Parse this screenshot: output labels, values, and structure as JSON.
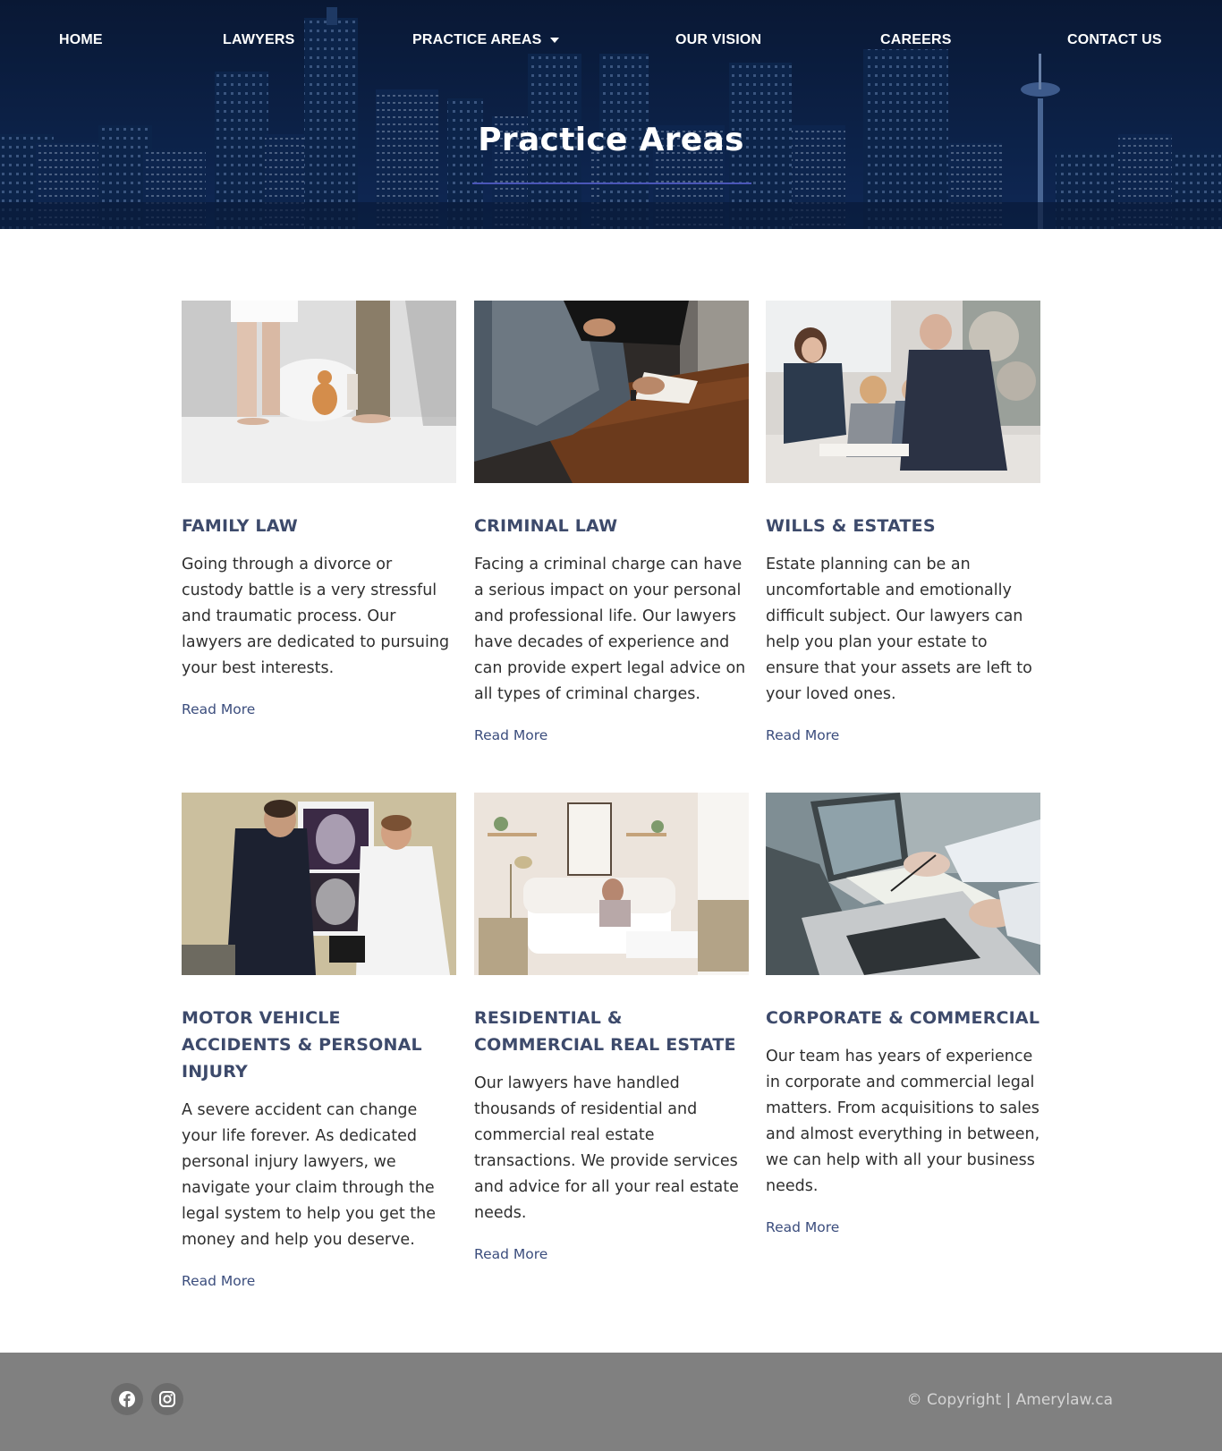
{
  "colors": {
    "hero_bg": "#0d2244",
    "title_color": "#3d4a6b",
    "link_color": "#3b4d7d",
    "footer_bg": "#808080",
    "accent_underline": "#4a56b8"
  },
  "nav": {
    "items": [
      {
        "label": "HOME"
      },
      {
        "label": "LAWYERS"
      },
      {
        "label": "PRACTICE AREAS",
        "icon": "caret-down-icon"
      },
      {
        "label": "OUR VISION"
      },
      {
        "label": "CAREERS"
      },
      {
        "label": "CONTACT US"
      }
    ]
  },
  "hero": {
    "title": "Practice Areas"
  },
  "cards": [
    {
      "title": "FAMILY LAW",
      "text": "Going through a divorce or custody battle is a very stressful and traumatic process. Our lawyers are dedicated to pursuing your best interests.",
      "link": "Read More",
      "image": "couple-with-cat-photo"
    },
    {
      "title": "CRIMINAL LAW",
      "text": "Facing a criminal charge can have a serious impact on your personal and professional life. Our lawyers have decades of experience and can provide expert legal advice on all types of criminal charges.",
      "link": "Read More",
      "image": "signing-document-photo"
    },
    {
      "title": "WILLS & ESTATES",
      "text": "Estate planning can be an uncomfortable and emotionally difficult subject. Our lawyers can help you plan your estate to ensure that your assets are left to your loved ones.",
      "link": "Read More",
      "image": "family-reading-photo"
    },
    {
      "title": "MOTOR VEHICLE ACCIDENTS & PERSONAL INJURY",
      "text": "A severe accident can change your life forever. As dedicated personal injury lawyers, we navigate your claim through the legal system to help you get the money and help you deserve.",
      "link": "Read More",
      "image": "doctor-xray-photo"
    },
    {
      "title": "RESIDENTIAL & COMMERCIAL REAL ESTATE",
      "text": "Our lawyers have handled thousands of residential and commercial real estate transactions. We provide services and advice for all your real estate needs.",
      "link": "Read More",
      "image": "living-room-photo"
    },
    {
      "title": "CORPORATE & COMMERCIAL",
      "text": "Our team has years of experience in corporate and commercial legal matters. From acquisitions to sales and almost everything in between, we can help with all your business needs.",
      "link": "Read More",
      "image": "laptop-notes-photo"
    }
  ],
  "footer": {
    "social": [
      {
        "icon": "facebook-icon"
      },
      {
        "icon": "instagram-icon"
      }
    ],
    "copyright": "© Copyright | Amerylaw.ca"
  }
}
